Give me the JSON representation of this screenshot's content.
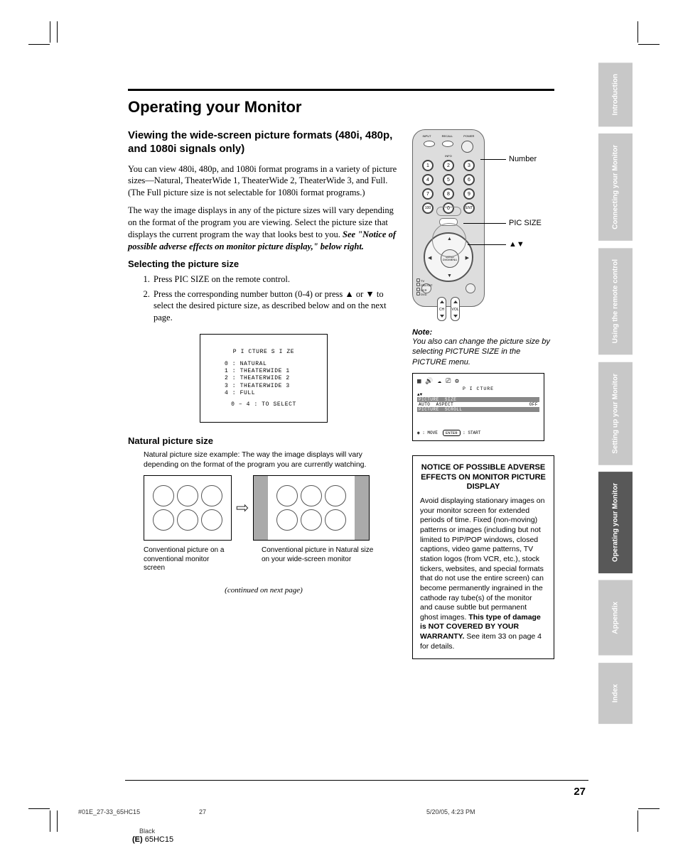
{
  "title": "Operating your Monitor",
  "subtitle": "Viewing the wide-screen picture formats (480i, 480p, and 1080i signals only)",
  "para1": "You can view 480i, 480p, and 1080i format programs in a variety of picture sizes—Natural, TheaterWide 1, TheaterWide 2, TheaterWide 3, and Full. (The Full picture size is not selectable for 1080i format programs.)",
  "para2a": "The way the image displays in any of the picture sizes will vary depending on the format of the program you are viewing. Select the picture size that displays the current program the way that looks best to you. ",
  "para2b": "See \"Notice of possible adverse effects on monitor picture display,\" below right.",
  "h3_select": "Selecting the picture size",
  "step1": "Press PIC SIZE on the remote control.",
  "step2": "Press the corresponding number button (0-4) or press ▲ or ▼ to select the desired picture size, as described below and on the next page.",
  "osd": {
    "title": "P I CTURE  S I ZE",
    "l0": "0 : NATURAL",
    "l1": "1 : THEATERWIDE  1",
    "l2": "2 : THEATERWIDE  2",
    "l3": "3 : THEATERWIDE  3",
    "l4": "4 : FULL",
    "sel": "0 – 4  :  TO  SELECT"
  },
  "remote_labels": {
    "input": "INPUT",
    "recall": "RECALL",
    "info": "INFO",
    "power": "POWER",
    "menu": "MENU",
    "dvdmenu": "DVDMENU",
    "ch": "CH",
    "vol": "VOL",
    "tv": "TV",
    "cbl": "CBL/SAT",
    "vcr": "VCR",
    "dvd": "DVD"
  },
  "numbers": [
    "1",
    "2",
    "3",
    "4",
    "5",
    "6",
    "7",
    "8",
    "9",
    "100",
    "0",
    "ENT"
  ],
  "callout": {
    "number": "Number",
    "picsize": "PIC SIZE",
    "arrows": "▲▼"
  },
  "note": {
    "hdr": "Note:",
    "txt": "You also can change the picture size by selecting PICTURE SIZE in the PICTURE menu."
  },
  "menu": {
    "title": "P I CTURE",
    "r1a": "PICTURE  SIZE",
    "r2a": "AUTO  ASPECT",
    "r2b": "OFF",
    "r3a": "PICTURE  SCROLL",
    "foot_move": ": MOVE",
    "foot_enter": "ENTER",
    "foot_start": ": START"
  },
  "notice": {
    "title": "NOTICE OF POSSIBLE ADVERSE EFFECTS ON MONITOR PICTURE DISPLAY",
    "body1": "Avoid displaying stationary images on your monitor screen for extended periods of time. Fixed (non-moving) patterns or images (including but not limited to PIP/POP windows, closed captions, video game patterns, TV station logos (from VCR, etc.), stock tickers, websites, and special formats that do not use the entire screen) can become permanently ingrained in the cathode ray tube(s) of the monitor and cause subtle but permanent ghost images. ",
    "body2": "This type of damage is NOT COVERED BY YOUR WARRANTY.",
    "body3": " See item 33 on page 4 for details."
  },
  "natural": {
    "h": "Natural picture size",
    "intro": "Natural picture size example: The way the image displays will vary depending on the format of the program you are currently watching.",
    "cap1": "Conventional picture on a conventional monitor screen",
    "cap2": "Conventional picture in Natural size on your wide-screen monitor"
  },
  "continued": "(continued on next page)",
  "tabs": [
    "Introduction",
    "Connecting your Monitor",
    "Using the remote control",
    "Setting up your Monitor",
    "Operating your Monitor",
    "Appendix",
    "Index"
  ],
  "page_number": "27",
  "footer": {
    "file": "#01E_27-33_65HC15",
    "pg": "27",
    "date": "5/20/05, 4:23 PM",
    "color": "Black",
    "model_prefix": "(E)",
    "model": " 65HC15"
  }
}
